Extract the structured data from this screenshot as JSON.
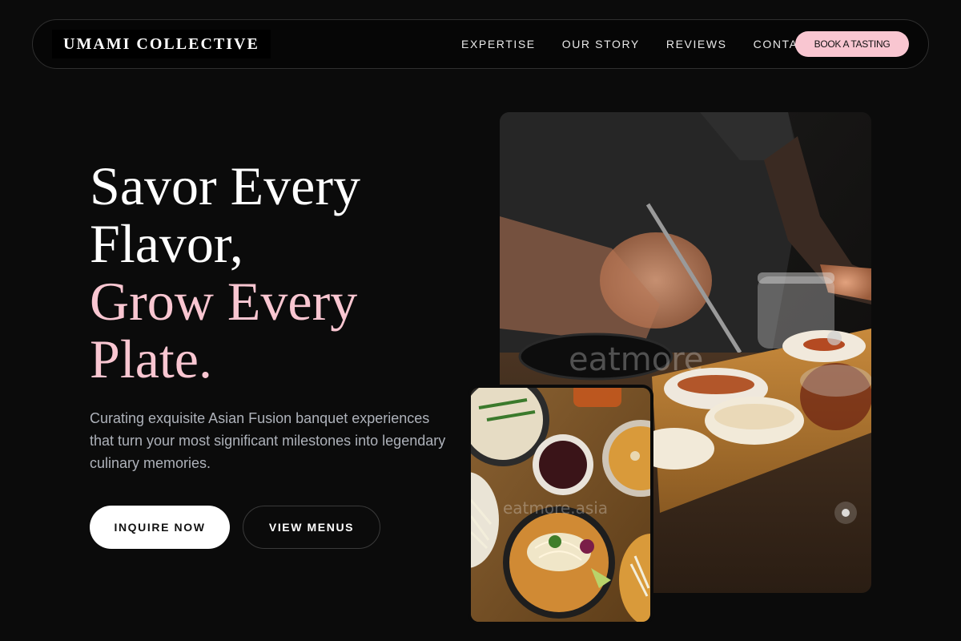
{
  "brand": {
    "name": "UMAMI COLLECTIVE"
  },
  "nav": {
    "links": [
      "EXPERTISE",
      "OUR STORY",
      "REVIEWS",
      "CONTACT"
    ],
    "cta": "BOOK A TASTING"
  },
  "hero": {
    "headline_lines": [
      "Savor Every",
      "Flavor,"
    ],
    "accent_lines": [
      "Grow Every",
      "Plate."
    ],
    "subtitle": "Curating exquisite Asian Fusion banquet experiences that turn your most significant milestones into legendary culinary memories.",
    "primary_button": "INQUIRE NOW",
    "secondary_button": "VIEW MENUS"
  },
  "images": {
    "main_watermark": "eatmore",
    "small_watermark": "eatmore.asia"
  },
  "colors": {
    "background": "#0b0b0b",
    "accent_pink": "#f9c6d1",
    "subtitle_gray": "#aeb2ba"
  }
}
